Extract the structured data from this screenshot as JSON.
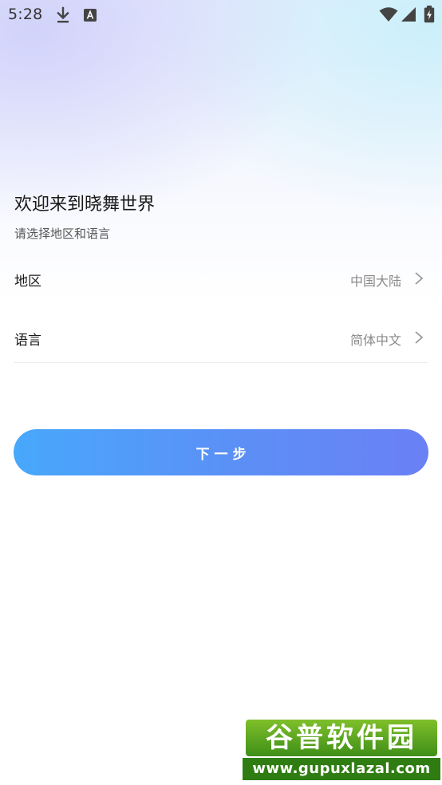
{
  "status_bar": {
    "time": "5:28",
    "icons": [
      "download-icon",
      "a-icon",
      "wifi-icon",
      "signal-icon",
      "battery-icon"
    ]
  },
  "welcome": {
    "title": "欢迎来到晓舞世界",
    "subtitle": "请选择地区和语言"
  },
  "settings": {
    "region": {
      "label": "地区",
      "value": "中国大陆"
    },
    "language": {
      "label": "语言",
      "value": "简体中文"
    }
  },
  "next_button": {
    "label": "下一步"
  },
  "watermark": {
    "title": "谷普软件园",
    "url": "www.gupuxlazal.com"
  },
  "colors": {
    "button_gradient_start": "#48a8fb",
    "button_gradient_end": "#6a80f5",
    "value_text": "#8a8a8a",
    "watermark_green": "#2f7d12"
  }
}
